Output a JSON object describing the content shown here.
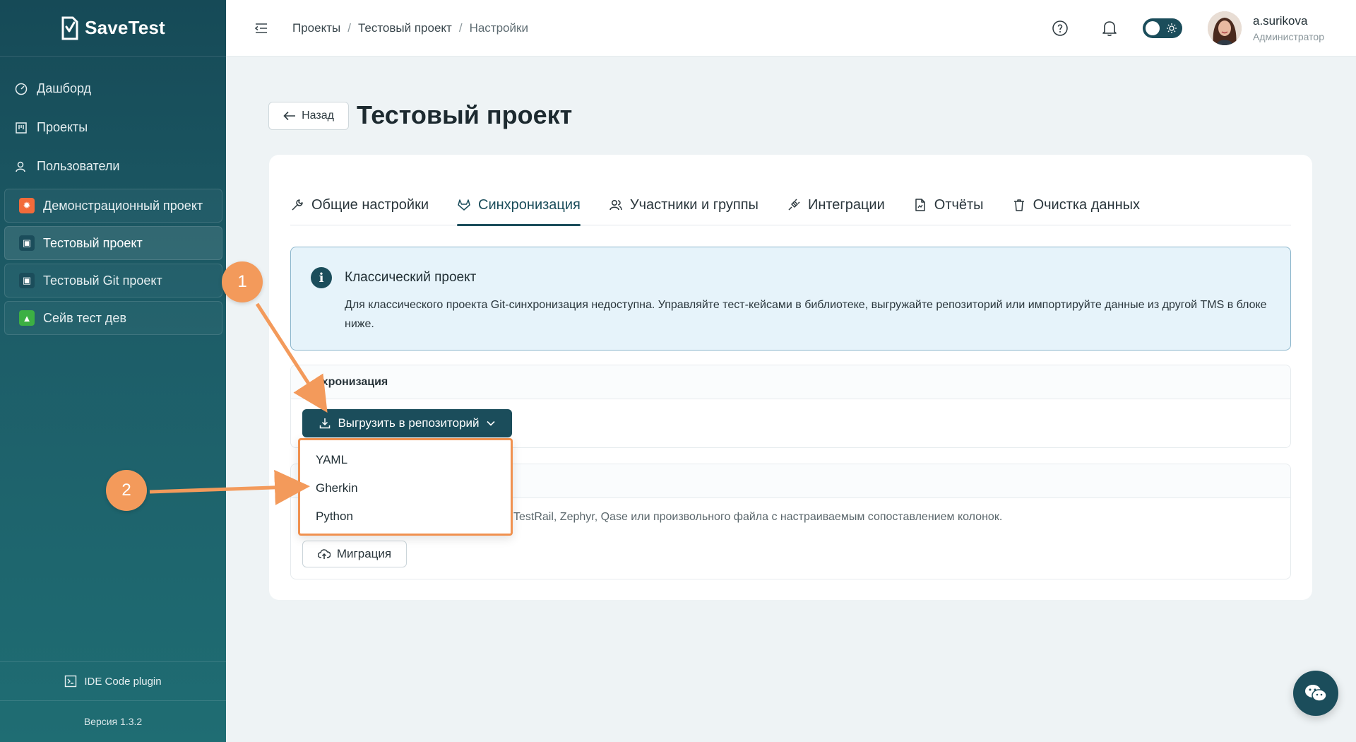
{
  "app": {
    "name": "SaveTest"
  },
  "sidebar": {
    "nav": [
      {
        "label": "Дашборд",
        "icon": "dashboard-icon"
      },
      {
        "label": "Проекты",
        "icon": "projects-icon"
      },
      {
        "label": "Пользователи",
        "icon": "users-icon"
      }
    ],
    "projects": [
      {
        "label": "Демонстрационный проект",
        "badge_color": "#f26b3a",
        "active": false
      },
      {
        "label": "Тестовый проект",
        "badge_color": "#1b4d5b",
        "active": true
      },
      {
        "label": "Тестовый Git проект",
        "badge_color": "#1b4d5b",
        "active": false
      },
      {
        "label": "Сейв тест дев",
        "badge_color": "#3cb043",
        "active": false
      }
    ],
    "ide_plugin": "IDE Code plugin",
    "version": "Версия 1.3.2"
  },
  "header": {
    "breadcrumb": [
      "Проекты",
      "Тестовый проект",
      "Настройки"
    ],
    "separator": "/",
    "user": {
      "name": "a.surikova",
      "role": "Администратор"
    }
  },
  "page": {
    "back_label": "Назад",
    "title": "Тестовый проект",
    "tabs": [
      {
        "label": "Общие настройки",
        "icon": "wrench-icon"
      },
      {
        "label": "Синхронизация",
        "icon": "gitlab-icon",
        "active": true
      },
      {
        "label": "Участники и группы",
        "icon": "users-icon"
      },
      {
        "label": "Интеграции",
        "icon": "plug-icon"
      },
      {
        "label": "Отчёты",
        "icon": "report-icon"
      },
      {
        "label": "Очистка данных",
        "icon": "trash-icon"
      }
    ],
    "info": {
      "title": "Классический проект",
      "text": "Для классического проекта Git-синхронизация недоступна. Управляйте тест-кейсами в библиотеке, выгружайте репозиторий или импортируйте данные из другой TMS в блоке ниже."
    },
    "sync_section": {
      "title": "нхронизация",
      "export_button": "Выгрузить в репозиторий"
    },
    "import_section": {
      "description": "TestRail, Zephyr, Qase или произвольного файла с настраиваемым сопоставлением колонок.",
      "migrate_button": "Миграция"
    },
    "dropdown": [
      "YAML",
      "Gherkin",
      "Python"
    ]
  },
  "annotations": {
    "marker1": "1",
    "marker2": "2",
    "color": "#f39a5b"
  },
  "colors": {
    "accent": "#1b4d5b",
    "annotation": "#f0914f"
  }
}
